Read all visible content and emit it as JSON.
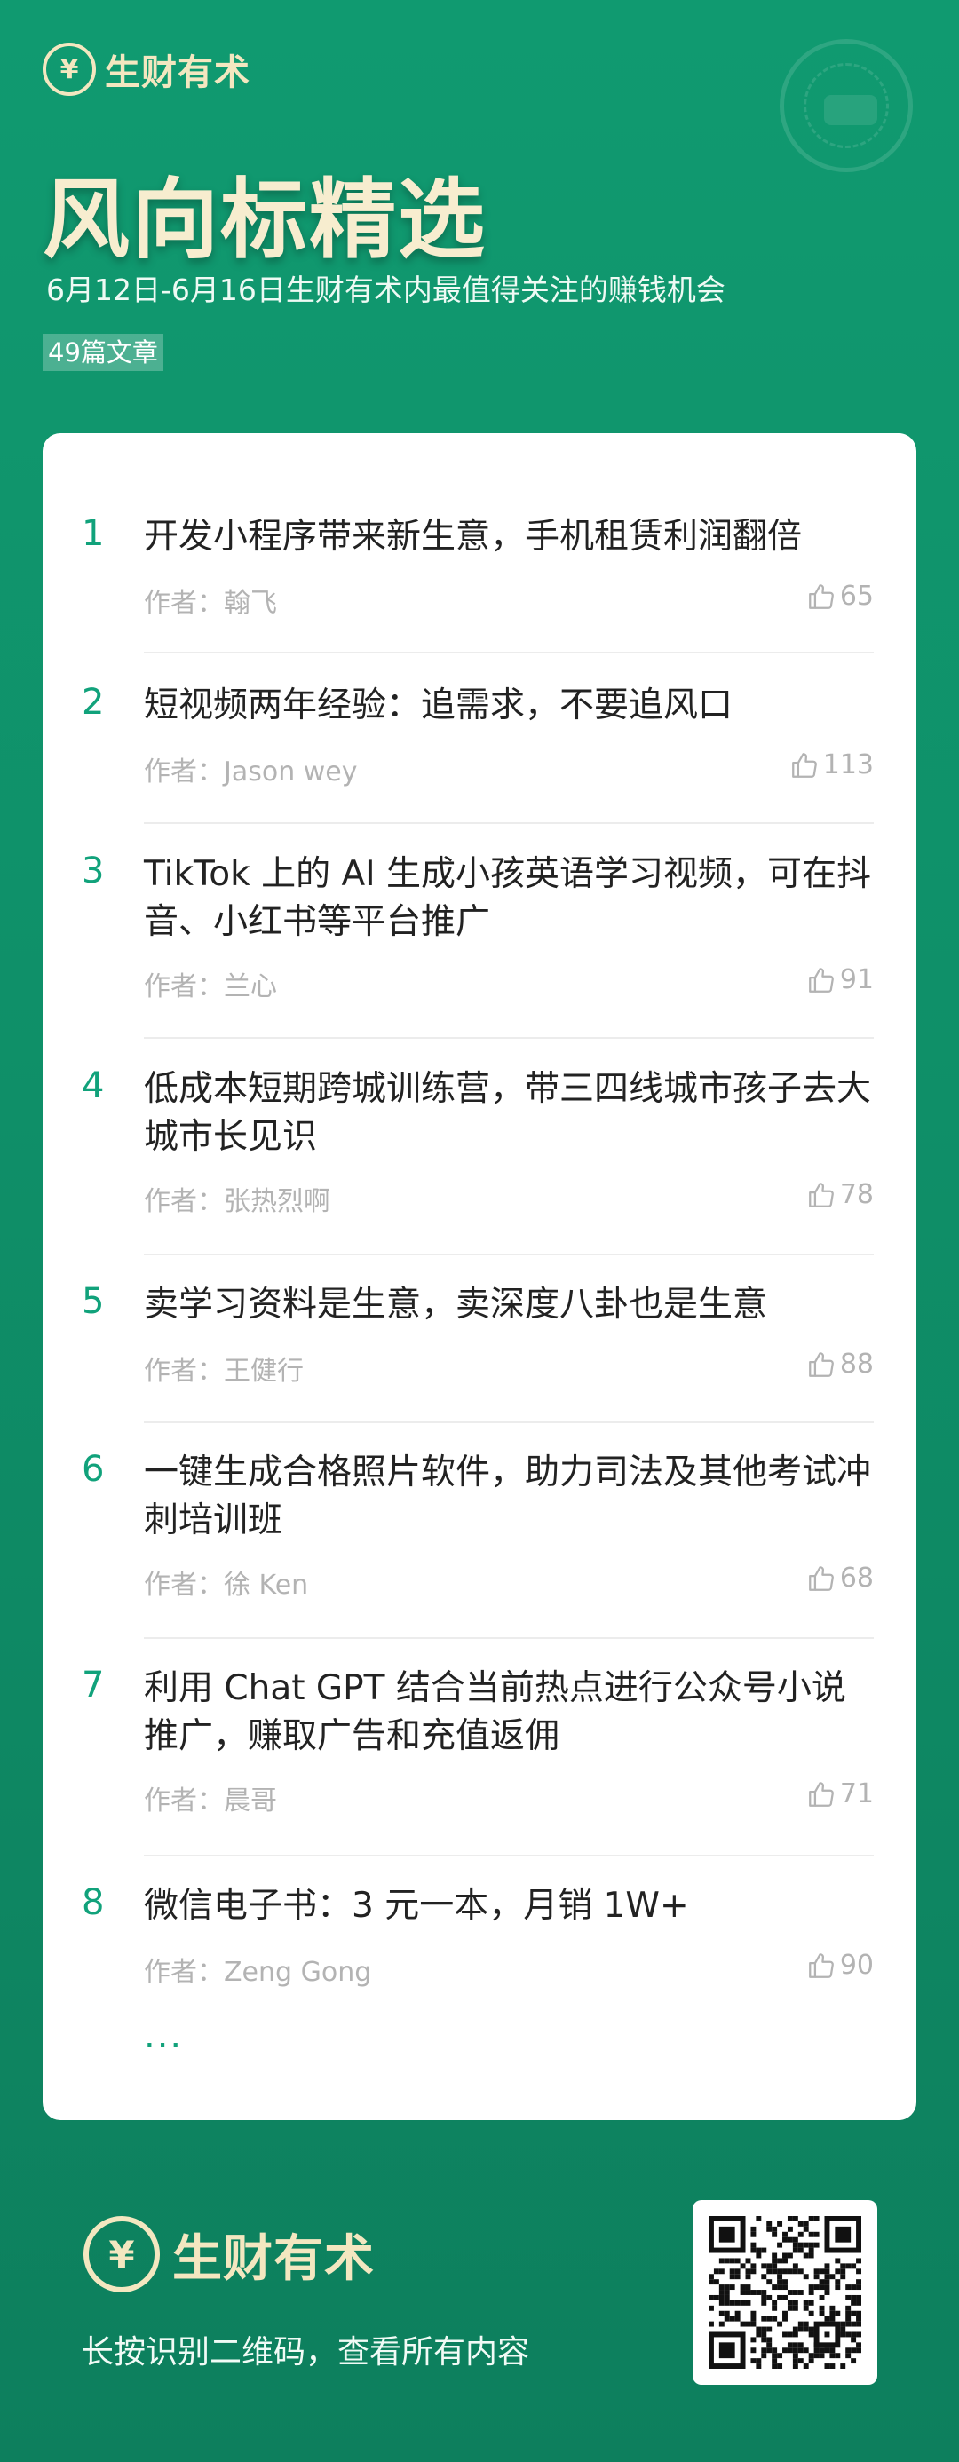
{
  "brand": {
    "logo_glyph": "¥",
    "name": "生财有术"
  },
  "header": {
    "title": "风向标精选",
    "subtitle": "6月12日-6月16日生财有术内最值得关注的赚钱机会",
    "article_count": "49篇文章"
  },
  "articles": [
    {
      "num": "1",
      "title": "开发小程序带来新生意，手机租赁利润翻倍",
      "author": "作者：翰飞",
      "likes": "65"
    },
    {
      "num": "2",
      "title": "短视频两年经验：追需求，不要追风口",
      "author": "作者：Jason wey",
      "likes": "113"
    },
    {
      "num": "3",
      "title": "TikTok 上的 AI 生成小孩英语学习视频，可在抖音、小红书等平台推广",
      "author": "作者：兰心",
      "likes": "91"
    },
    {
      "num": "4",
      "title": "低成本短期跨城训练营，带三四线城市孩子去大城市长见识",
      "author": "作者：张热烈啊",
      "likes": "78"
    },
    {
      "num": "5",
      "title": "卖学习资料是生意，卖深度八卦也是生意",
      "author": "作者：王健行",
      "likes": "88"
    },
    {
      "num": "6",
      "title": "一键生成合格照片软件，助力司法及其他考试冲刺培训班",
      "author": "作者：徐 Ken",
      "likes": "68"
    },
    {
      "num": "7",
      "title": "利用 Chat GPT 结合当前热点进行公众号小说推广，赚取广告和充值返佣",
      "author": "作者：晨哥",
      "likes": "71"
    },
    {
      "num": "8",
      "title": "微信电子书：3 元一本，月销 1W+",
      "author": "作者：Zeng Gong",
      "likes": "90"
    }
  ],
  "more_indicator": "...",
  "footer": {
    "brand_name": "生财有术",
    "caption": "长按识别二维码，查看所有内容"
  },
  "icons": {
    "like": "thumbs-up-icon",
    "qr": "qr-code-icon",
    "logo": "yuan-logo-icon"
  },
  "colors": {
    "background": "#0f8f68",
    "accent": "#11a27b",
    "title_gold": "#f7edcf"
  }
}
